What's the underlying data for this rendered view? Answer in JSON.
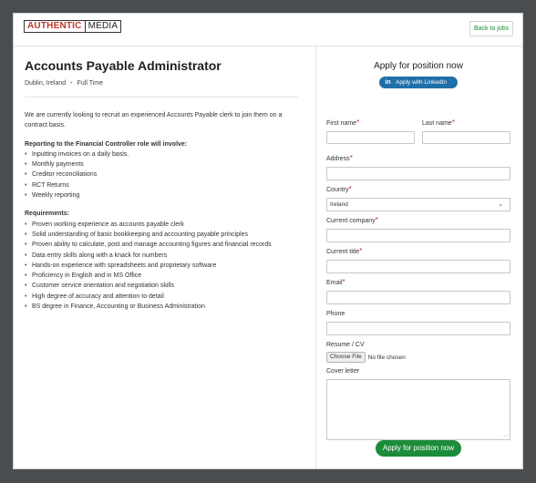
{
  "header": {
    "logo_part1": "AUTHENTIC",
    "logo_part2": "MEDIA",
    "back_label": "Back to jobs"
  },
  "job": {
    "title": "Accounts Payable Administrator",
    "location": "Dublin, Ireland",
    "type": "Full Time",
    "intro": "We are currently looking to recruit an experienced Accounts Payable clerk to join them on a contract basis.",
    "reporting_title": "Reporting to the Financial Controller role will involve:",
    "duties": [
      "Inputting invoices on a daily basis.",
      "Monthly payments",
      "Creditor reconciliations",
      "RCT Returns",
      "Weekly reporting"
    ],
    "requirements_title": "Requirements:",
    "requirements": [
      "Proven working experience as accounts payable clerk",
      "Solid understanding of basic bookkeeping and accounting payable principles",
      "Proven ability to calculate, post and manage accounting figures and financial records",
      "Data entry skills along with a knack for numbers",
      "Hands-on experience with spreadsheets and proprietary software",
      "Proficiency in English and in MS Office",
      "Customer service orientation and negotiation skills",
      "High degree of accuracy and attention to detail",
      "BS degree in Finance, Accounting or Business Administration"
    ]
  },
  "form": {
    "title": "Apply for position now",
    "linkedin_label": "Apply with LinkedIn",
    "first_name_label": "First name",
    "last_name_label": "Last name",
    "address_label": "Address",
    "country_label": "Country",
    "country_value": "Ireland",
    "current_company_label": "Current company",
    "current_title_label": "Current title",
    "email_label": "Email",
    "phone_label": "Phone",
    "resume_label": "Resume / CV",
    "choose_file_label": "Choose File",
    "no_file_label": "No file chosen",
    "cover_letter_label": "Cover letter",
    "submit_label": "Apply for position now",
    "required_mark": "*"
  },
  "colors": {
    "accent_green": "#1d8c3a",
    "linkedin_blue": "#1f6fa8",
    "required_red": "#c0392b",
    "logo_red": "#c0392b"
  }
}
